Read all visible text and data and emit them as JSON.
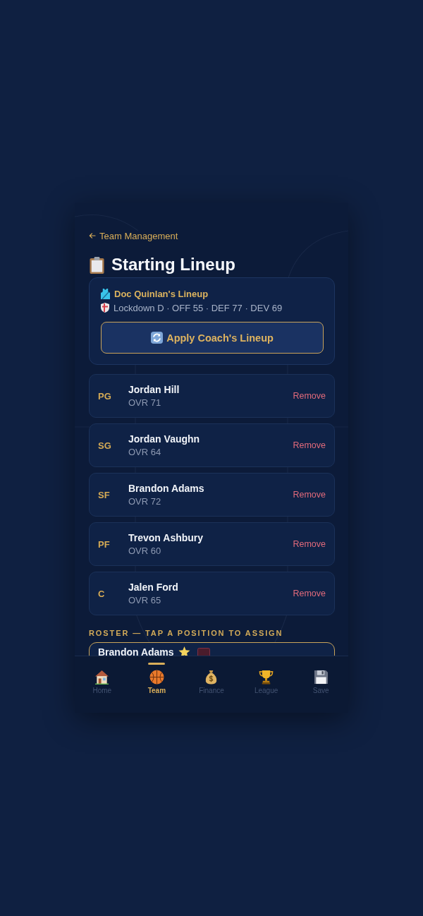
{
  "back_link": {
    "label": "Team Management"
  },
  "title": "Starting Lineup",
  "coach_card": {
    "name": "Doc Quinlan's Lineup",
    "summary": "Lockdown D · OFF 55 · DEF 77 · DEV 69",
    "button": "Apply Coach's Lineup"
  },
  "lineup": [
    {
      "position": "PG",
      "name": "Jordan Hill",
      "rating": "OVR 71",
      "action": "Remove"
    },
    {
      "position": "SG",
      "name": "Jordan Vaughn",
      "rating": "OVR 64",
      "action": "Remove"
    },
    {
      "position": "SF",
      "name": "Brandon Adams",
      "rating": "OVR 72",
      "action": "Remove"
    },
    {
      "position": "PF",
      "name": "Trevon Ashbury",
      "rating": "OVR 60",
      "action": "Remove"
    },
    {
      "position": "C",
      "name": "Jalen Ford",
      "rating": "OVR 65",
      "action": "Remove"
    }
  ],
  "roster": {
    "heading": "ROSTER — TAP A POSITION TO ASSIGN",
    "players": [
      {
        "name": "Brandon Adams",
        "starred": true
      }
    ]
  },
  "nav": [
    {
      "label": "Home",
      "selected": false
    },
    {
      "label": "Team",
      "selected": true
    },
    {
      "label": "Finance",
      "selected": false
    },
    {
      "label": "League",
      "selected": false
    },
    {
      "label": "Save",
      "selected": false
    }
  ]
}
